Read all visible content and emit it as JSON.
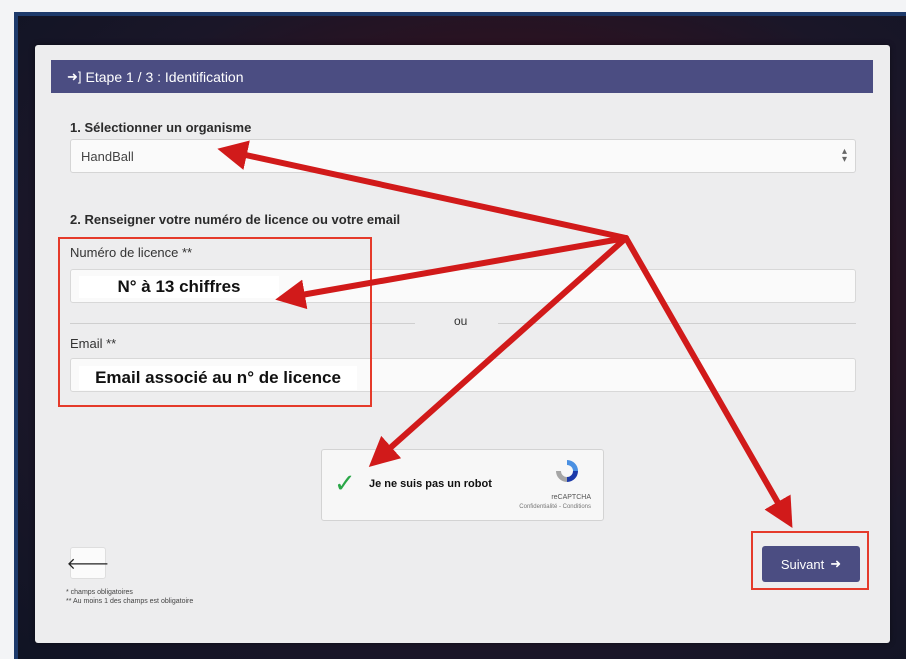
{
  "header": {
    "icon": "sign-in-icon",
    "title": "Etape 1 / 3 : Identification"
  },
  "section1": {
    "title": "1. Sélectionner un organisme",
    "selected": "HandBall"
  },
  "section2": {
    "title": "2. Renseigner votre numéro de licence ou votre email",
    "licence_label": "Numéro de licence **",
    "licence_hint": "N° à 13 chiffres",
    "separator": "ou",
    "email_label": "Email **",
    "email_hint": "Email associé au n° de licence"
  },
  "captcha": {
    "label": "Je ne suis pas un robot",
    "brand": "reCAPTCHA",
    "links": "Confidentialité - Conditions"
  },
  "buttons": {
    "back_icon": "arrow-left-icon",
    "next_label": "Suivant"
  },
  "footnotes": {
    "line1": "* champs obligatoires",
    "line2": "** Au moins 1 des champs est obligatoire"
  },
  "annotation": {
    "color": "#d11a1a",
    "icon": "red-arrows-annotation"
  }
}
